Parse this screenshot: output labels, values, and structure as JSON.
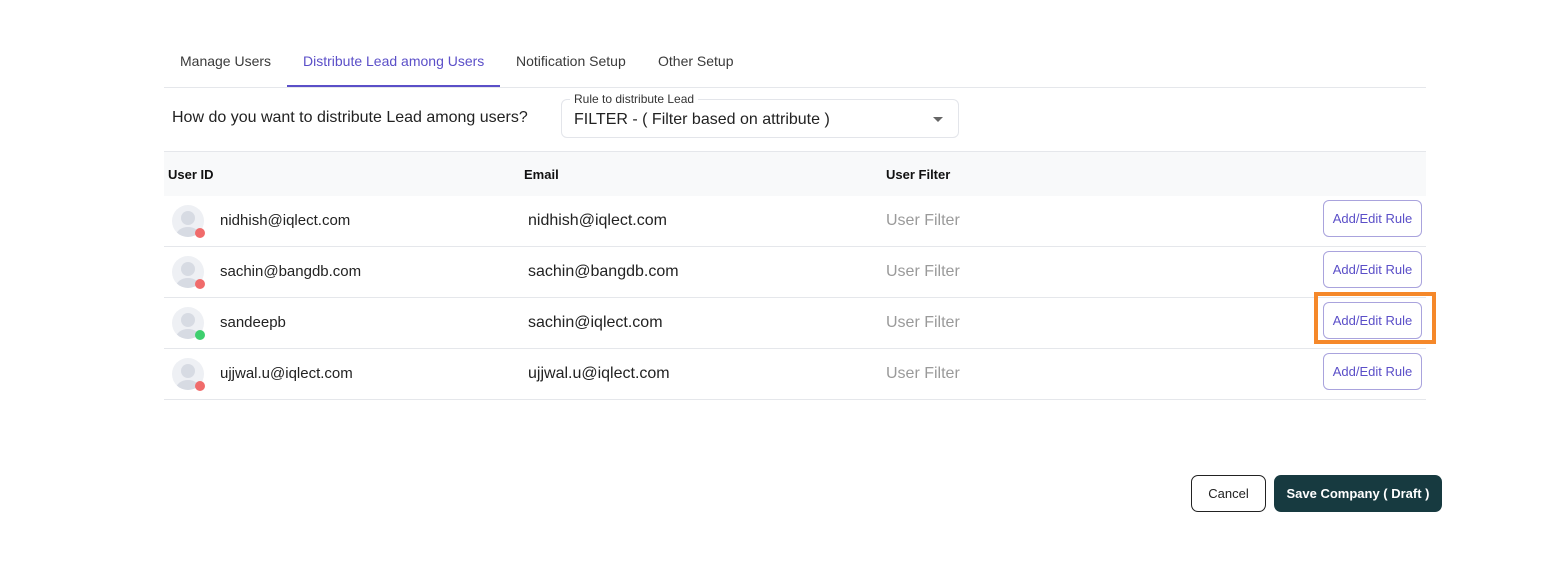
{
  "tabs": [
    {
      "label": "Manage Users",
      "active": false
    },
    {
      "label": "Distribute Lead among Users",
      "active": true
    },
    {
      "label": "Notification Setup",
      "active": false
    },
    {
      "label": "Other Setup",
      "active": false
    }
  ],
  "distribution": {
    "question": "How do you want to distribute Lead among users?",
    "select_label": "Rule to distribute Lead",
    "select_value": "FILTER - ( Filter based on attribute )"
  },
  "table": {
    "headers": [
      "User ID",
      "Email",
      "User Filter"
    ],
    "rows": [
      {
        "user_id": "nidhish@iqlect.com",
        "email": "nidhish@iqlect.com",
        "filter_placeholder": "User Filter",
        "status": "offline",
        "button": "Add/Edit Rule"
      },
      {
        "user_id": "sachin@bangdb.com",
        "email": "sachin@bangdb.com",
        "filter_placeholder": "User Filter",
        "status": "offline",
        "button": "Add/Edit Rule"
      },
      {
        "user_id": "sandeepb",
        "email": "sachin@iqlect.com",
        "filter_placeholder": "User Filter",
        "status": "online",
        "button": "Add/Edit Rule"
      },
      {
        "user_id": "ujjwal.u@iqlect.com",
        "email": "ujjwal.u@iqlect.com",
        "filter_placeholder": "User Filter",
        "status": "offline",
        "button": "Add/Edit Rule"
      }
    ]
  },
  "status_colors": {
    "online": "#3ecf6e",
    "offline": "#f06b6b"
  },
  "accent_color": "#5b4fc8",
  "highlight_color": "#f5882a",
  "footer": {
    "cancel_label": "Cancel",
    "save_label": "Save Company ( Draft )"
  }
}
